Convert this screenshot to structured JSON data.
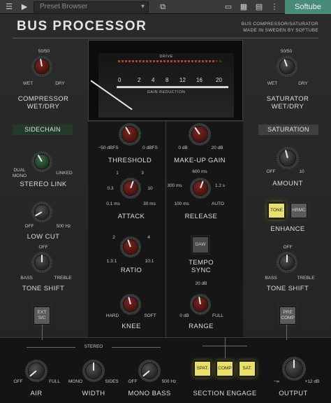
{
  "host_bar": {
    "preset_placeholder": "Preset Browser",
    "logo": "Softube",
    "icons": [
      "ab-compare-icon",
      "play-icon",
      "chevron-down-icon",
      "window-icon",
      "panel-icon",
      "grid-icon",
      "layout-icon"
    ]
  },
  "header": {
    "title": "BUS PROCESSOR",
    "subtitle_line1": "BUS COMPRESSOR/SATURATOR",
    "subtitle_line2": "MADE IN SWEDEN BY SOFTUBE"
  },
  "meter": {
    "drive_label": "DRIVE",
    "gr_label": "GAIN REDUCTION",
    "scale": [
      "0",
      "2",
      "4",
      "8",
      "12",
      "16",
      "20"
    ]
  },
  "compressor_wetdry": {
    "label_line1": "COMPRESSOR",
    "label_line2": "WET/DRY",
    "top": "50/50",
    "left": "WET",
    "right": "DRY"
  },
  "saturator_wetdry": {
    "label_line1": "SATURATOR",
    "label_line2": "WET/DRY",
    "top": "50/50",
    "left": "WET",
    "right": "DRY"
  },
  "sidechain": {
    "header": "SIDECHAIN",
    "stereo_link": {
      "label": "STEREO LINK",
      "left_line1": "DUAL",
      "left_line2": "MONO",
      "right": "LINKED"
    },
    "low_cut": {
      "label": "LOW CUT",
      "left": "OFF",
      "right": "500 Hz"
    },
    "tone_shift": {
      "label": "TONE SHIFT",
      "top": "OFF",
      "left": "BASS",
      "right": "TREBLE"
    },
    "ext_button_line1": "EXT",
    "ext_button_line2": "S/C"
  },
  "compressor": {
    "threshold": {
      "label": "THRESHOLD",
      "left": "−50 dBFS",
      "right": "0 dBFS"
    },
    "makeup": {
      "label": "MAKE-UP GAIN",
      "left": "0 dB",
      "right": "20 dB"
    },
    "attack": {
      "label": "ATTACK",
      "s1": "1",
      "s3": "3",
      "s03": "0.3",
      "s10": "10",
      "s01": "0.1 ms",
      "s30": "30 ms"
    },
    "release": {
      "label": "RELEASE",
      "top": "600 ms",
      "left": "300 ms",
      "right": "1.2 s",
      "bl": "100 ms",
      "br": "AUTO"
    },
    "ratio": {
      "label": "RATIO",
      "s2": "2",
      "s4": "4",
      "s131": "1.3:1",
      "s101": "10:1"
    },
    "tempo_sync": {
      "label_line1": "TEMPO",
      "label_line2": "SYNC",
      "button": "DAW"
    },
    "knee": {
      "label": "KNEE",
      "left": "HARD",
      "right": "SOFT"
    },
    "range": {
      "label": "RANGE",
      "top": "20 dB",
      "left": "0 dB",
      "right": "FULL"
    }
  },
  "saturation": {
    "header": "SATURATION",
    "amount": {
      "label": "AMOUNT",
      "left": "OFF",
      "right": "10"
    },
    "enhance": {
      "label": "ENHANCE",
      "tone": "TONE",
      "hrmc": "HRMC"
    },
    "tone_shift": {
      "label": "TONE SHIFT",
      "top": "OFF",
      "left": "BASS",
      "right": "TREBLE"
    },
    "pre_comp_line1": "PRE",
    "pre_comp_line2": "COMP"
  },
  "bottom": {
    "stereo_label": "STEREO",
    "air": {
      "label": "AIR",
      "left": "OFF",
      "right": "FULL"
    },
    "width": {
      "label": "WIDTH",
      "left": "MONO",
      "right": "SIDES"
    },
    "mono_bass": {
      "label": "MONO BASS",
      "left": "OFF",
      "right": "500 Hz"
    },
    "section_engage": {
      "label": "SECTION ENGAGE",
      "spat": "SPAT.",
      "comp": "COMP",
      "sat": "SAT."
    },
    "output": {
      "label": "OUTPUT",
      "left": "−∞",
      "right": "+12 dB"
    }
  }
}
